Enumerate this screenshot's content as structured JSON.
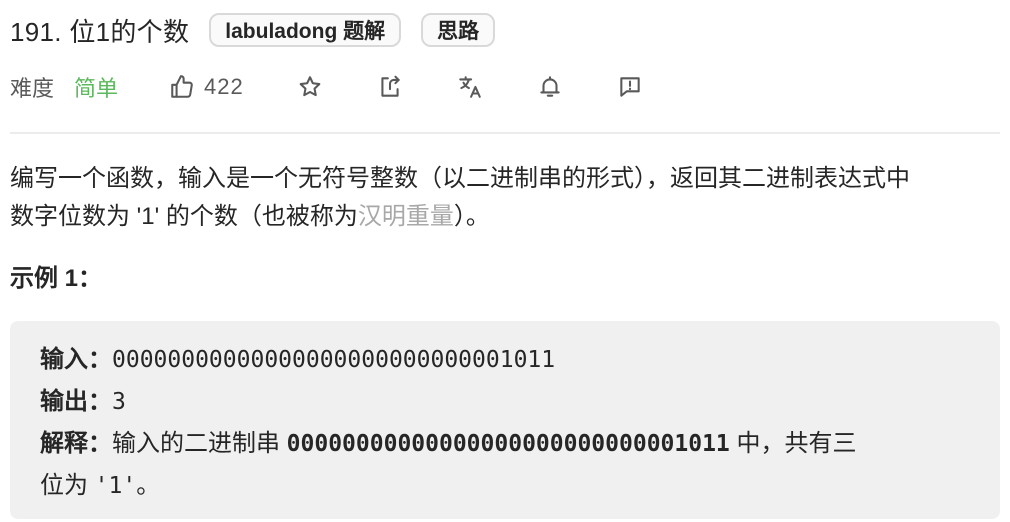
{
  "problem": {
    "title": "191. 位1的个数",
    "tags": [
      "labuladong 题解",
      "思路"
    ]
  },
  "meta": {
    "difficulty_label": "难度",
    "difficulty_value": "简单",
    "likes": "422",
    "icons": [
      "thumbs-up-icon",
      "star-icon",
      "share-icon",
      "translate-icon",
      "bell-icon",
      "feedback-icon"
    ],
    "difficulty_color": "#5cb85c"
  },
  "description": {
    "line1": "编写一个函数，输入是一个无符号整数（以二进制串的形式），返回其二进制表达式中",
    "line2_pre": "数字位数为 '1' 的个数（也被称为",
    "line2_link": "汉明重量",
    "line2_post": "）。"
  },
  "example": {
    "title": "示例 1：",
    "input_label": "输入：",
    "input_value": "00000000000000000000000000001011",
    "output_label": "输出：",
    "output_value": "3",
    "explain_label": "解释：",
    "explain_pre": "输入的二进制串 ",
    "explain_code": "00000000000000000000000000001011",
    "explain_post": " 中，共有三",
    "explain_line2_pre": "位为 ",
    "explain_line2_code": "'1'",
    "explain_line2_post": "。"
  }
}
